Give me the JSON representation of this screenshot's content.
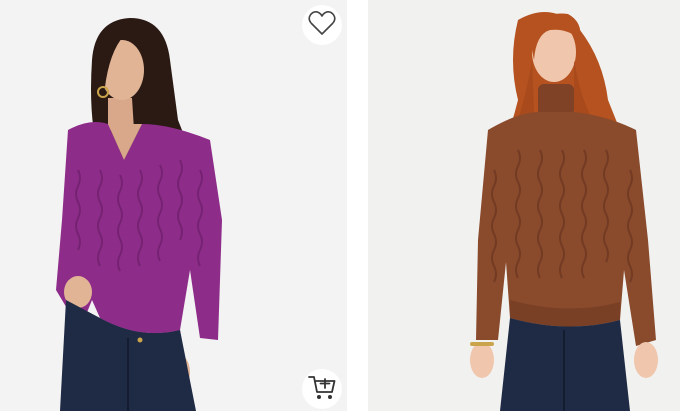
{
  "products": [
    {
      "model": "woman-purple-vneck-cable-sweater",
      "sweater_color": "#8e2c8a",
      "actions": {
        "favorite_icon": "heart-outline-icon",
        "cart_icon": "add-to-cart-icon"
      }
    },
    {
      "model": "woman-brown-turtleneck-cable-sweater",
      "sweater_color": "#8a4a2c"
    }
  ]
}
